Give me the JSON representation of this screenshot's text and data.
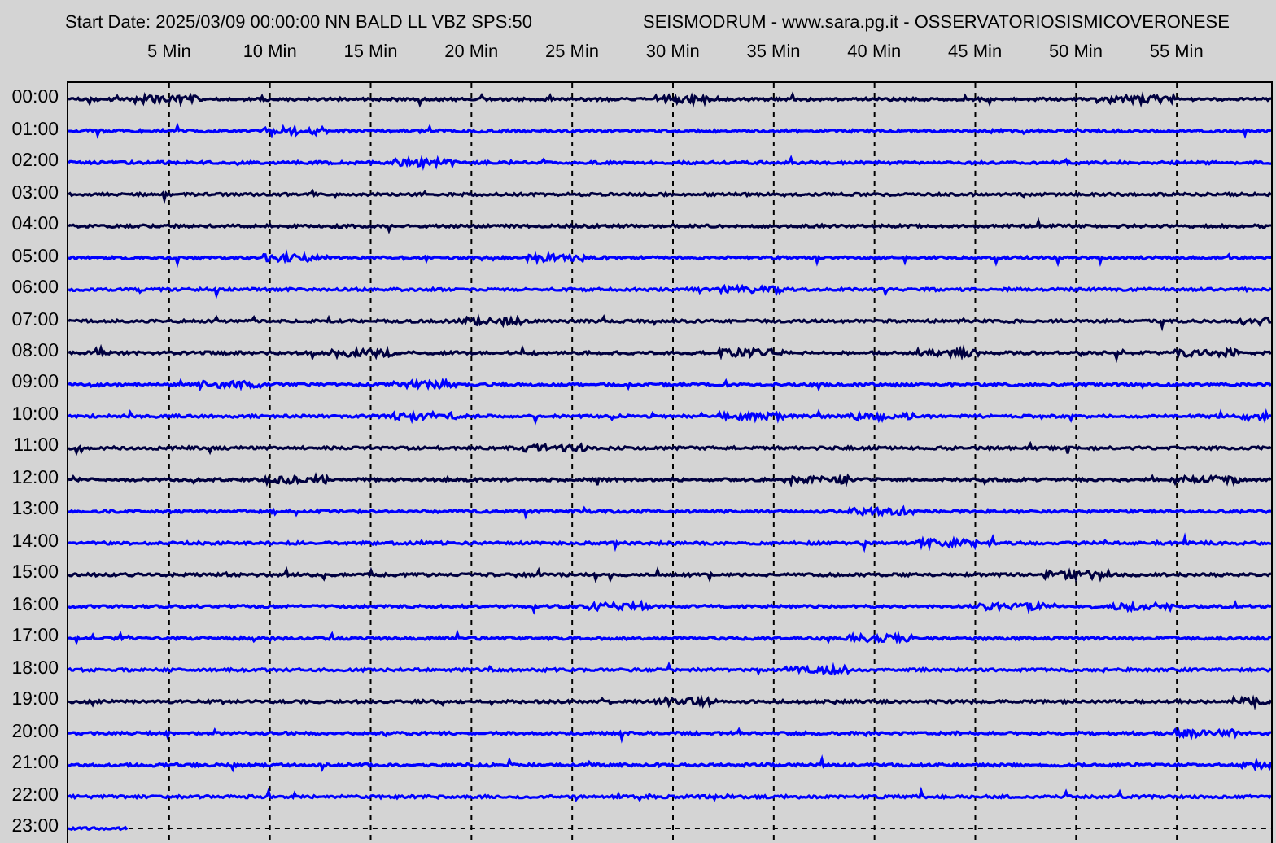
{
  "header": {
    "start_info": "Start Date: 2025/03/09 00:00:00 NN BALD LL VBZ SPS:50",
    "program_title": "SEISMODRUM - www.sara.pg.it - OSSERVATORIOSISMICOVERONESE"
  },
  "minute_labels": [
    "5 Min",
    "10 Min",
    "15 Min",
    "20 Min",
    "25 Min",
    "30 Min",
    "35 Min",
    "40 Min",
    "45 Min",
    "50 Min",
    "55 Min"
  ],
  "traces": [
    {
      "hour": "00:00",
      "color": "#000040",
      "level": 1
    },
    {
      "hour": "01:00",
      "color": "#0000ff",
      "level": 1
    },
    {
      "hour": "02:00",
      "color": "#0000ff",
      "level": 1
    },
    {
      "hour": "03:00",
      "color": "#000040",
      "level": 1
    },
    {
      "hour": "04:00",
      "color": "#000040",
      "level": 1
    },
    {
      "hour": "05:00",
      "color": "#0000ff",
      "level": 1
    },
    {
      "hour": "06:00",
      "color": "#0000ff",
      "level": 1
    },
    {
      "hour": "07:00",
      "color": "#000040",
      "level": 1
    },
    {
      "hour": "08:00",
      "color": "#000040",
      "level": 1
    },
    {
      "hour": "09:00",
      "color": "#0000ff",
      "level": 1
    },
    {
      "hour": "10:00",
      "color": "#0000ff",
      "level": 1
    },
    {
      "hour": "11:00",
      "color": "#000040",
      "level": 1
    },
    {
      "hour": "12:00",
      "color": "#000040",
      "level": 1
    },
    {
      "hour": "13:00",
      "color": "#0000ff",
      "level": 1
    },
    {
      "hour": "14:00",
      "color": "#0000ff",
      "level": 1
    },
    {
      "hour": "15:00",
      "color": "#000040",
      "level": 1
    },
    {
      "hour": "16:00",
      "color": "#0000ff",
      "level": 1
    },
    {
      "hour": "17:00",
      "color": "#0000ff",
      "level": 1
    },
    {
      "hour": "18:00",
      "color": "#0000ff",
      "level": 1
    },
    {
      "hour": "19:00",
      "color": "#000040",
      "level": 1
    },
    {
      "hour": "20:00",
      "color": "#0000ff",
      "level": 1
    },
    {
      "hour": "21:00",
      "color": "#0000ff",
      "level": 1
    },
    {
      "hour": "22:00",
      "color": "#0000ff",
      "level": 1
    },
    {
      "hour": "23:00",
      "color": "#0000ff",
      "level": 0.05
    }
  ]
}
